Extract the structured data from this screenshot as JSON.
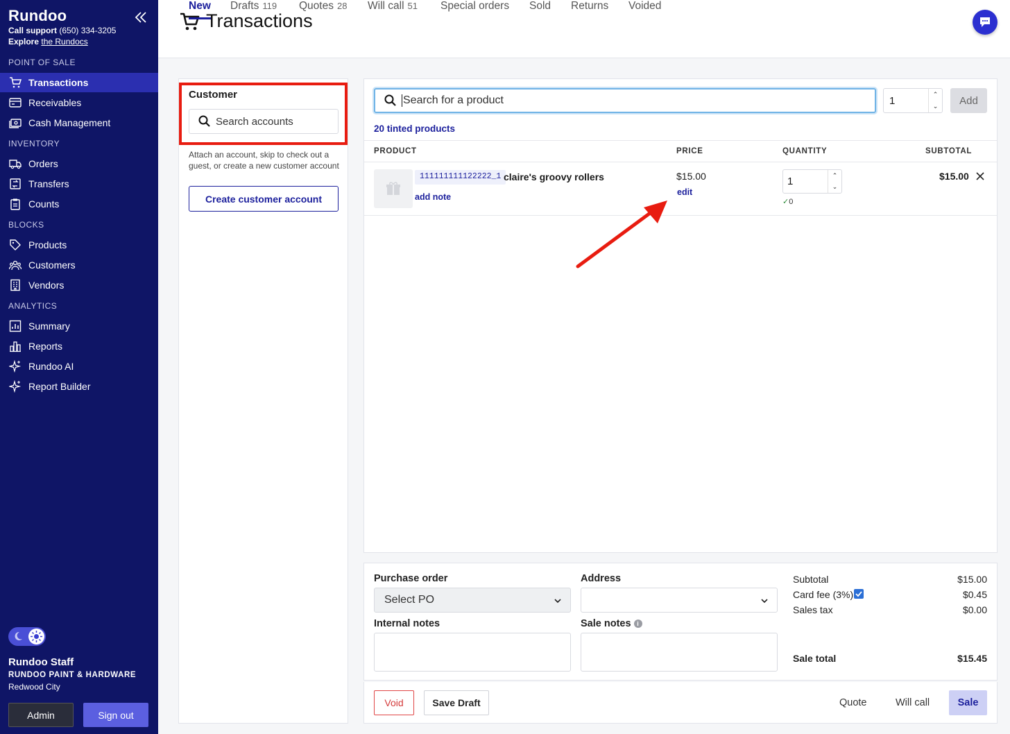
{
  "sidebar": {
    "brand": "Rundoo",
    "support_label": "Call support",
    "support_phone": "(650) 334-3205",
    "explore_label": "Explore",
    "explore_link": "the Rundocs",
    "sections": {
      "pos": "POINT OF SALE",
      "inventory": "INVENTORY",
      "blocks": "BLOCKS",
      "analytics": "ANALYTICS"
    },
    "items": {
      "transactions": "Transactions",
      "receivables": "Receivables",
      "cash_management": "Cash Management",
      "orders": "Orders",
      "transfers": "Transfers",
      "counts": "Counts",
      "products": "Products",
      "customers": "Customers",
      "vendors": "Vendors",
      "summary": "Summary",
      "reports": "Reports",
      "rundoo_ai": "Rundoo AI",
      "report_builder": "Report Builder"
    },
    "user": {
      "name": "Rundoo Staff",
      "org": "RUNDOO PAINT & HARDWARE",
      "city": "Redwood City"
    },
    "admin_label": "Admin",
    "signout_label": "Sign out"
  },
  "header": {
    "title": "Transactions",
    "tabs": [
      {
        "label": "New",
        "count": ""
      },
      {
        "label": "Drafts",
        "count": "119"
      },
      {
        "label": "Quotes",
        "count": "28"
      },
      {
        "label": "Will call",
        "count": "51"
      },
      {
        "label": "Special orders",
        "count": ""
      },
      {
        "label": "Sold",
        "count": ""
      },
      {
        "label": "Returns",
        "count": ""
      },
      {
        "label": "Voided",
        "count": ""
      }
    ]
  },
  "customer": {
    "label": "Customer",
    "search_placeholder": "Search accounts",
    "help": "Attach an account, skip to check out a guest, or create a new customer account",
    "create_label": "Create customer account"
  },
  "product_search": {
    "placeholder": "Search for a product",
    "qty": "1",
    "add_label": "Add",
    "tinted_link": "20 tinted products"
  },
  "table": {
    "headers": {
      "product": "PRODUCT",
      "price": "PRICE",
      "quantity": "QUANTITY",
      "subtotal": "SUBTOTAL"
    },
    "rows": [
      {
        "sku": "111111111122222_1",
        "name": "claire's groovy rollers",
        "add_note": "add note",
        "price": "$15.00",
        "edit": "edit",
        "qty": "1",
        "stock": "0",
        "subtotal": "$15.00"
      }
    ]
  },
  "order_details": {
    "po_label": "Purchase order",
    "po_value": "Select PO",
    "address_label": "Address",
    "address_value": "",
    "internal_notes_label": "Internal notes",
    "sale_notes_label": "Sale notes"
  },
  "totals": {
    "subtotal_label": "Subtotal",
    "subtotal": "$15.00",
    "card_fee_label": "Card fee (3%)",
    "card_fee": "$0.45",
    "card_fee_checked": true,
    "tax_label": "Sales tax",
    "tax": "$0.00",
    "total_label": "Sale total",
    "total": "$15.45"
  },
  "actions": {
    "void": "Void",
    "save_draft": "Save Draft",
    "quote": "Quote",
    "will_call": "Will call",
    "sale": "Sale"
  },
  "colors": {
    "sidebar_bg": "#0f1566",
    "accent": "#1b1f9c",
    "annotation_red": "#e81c10"
  },
  "annotations": {
    "highlight_box": "customer-section",
    "arrow_target": "price-edit-link"
  }
}
